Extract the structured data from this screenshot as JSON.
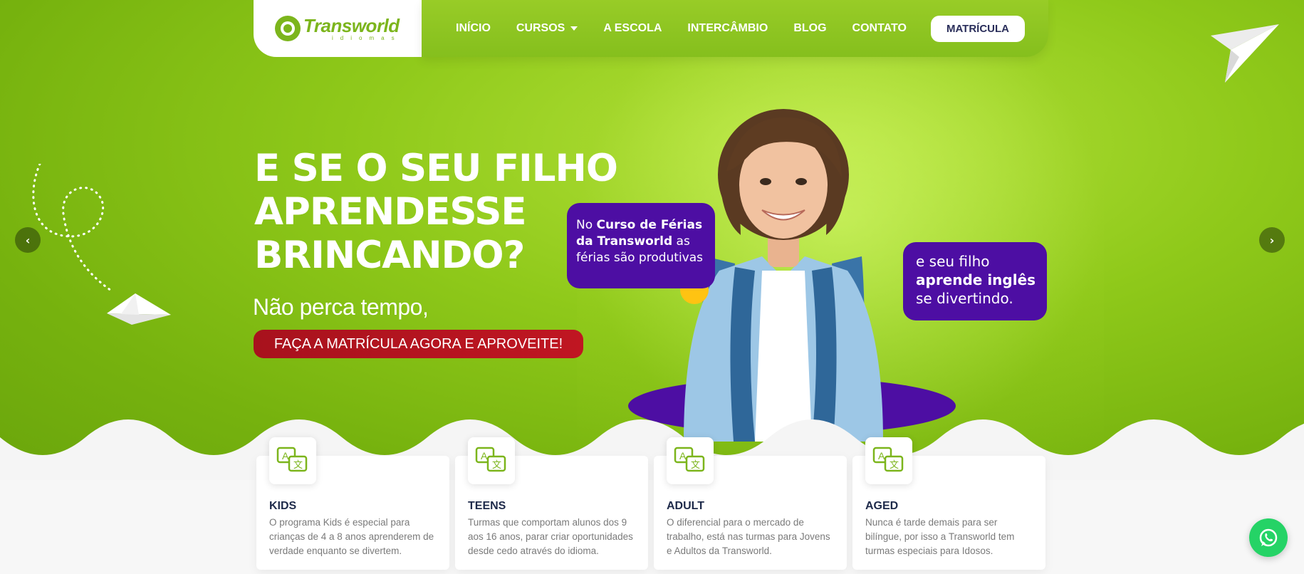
{
  "brand": {
    "logo_text": "Transworld",
    "logo_sub": "idiomas",
    "accent": "#7cb51c",
    "purple": "#4d0ea3",
    "red": "#b3141f"
  },
  "nav": {
    "items": [
      {
        "label": "INÍCIO"
      },
      {
        "label": "CURSOS",
        "has_dropdown": true
      },
      {
        "label": "A ESCOLA"
      },
      {
        "label": "INTERCÂMBIO"
      },
      {
        "label": "BLOG"
      },
      {
        "label": "CONTATO"
      }
    ],
    "cta_label": "MATRÍCULA"
  },
  "hero": {
    "headline_lines": [
      "E SE O SEU FILHO",
      "APRENDESSE",
      "BRINCANDO?"
    ],
    "subline": "Não perca tempo,",
    "cta_label": "FAÇA A MATRÍCULA AGORA E APROVEITE!",
    "bubble1": {
      "pre": "No ",
      "bold": "Curso de Férias da Transworld",
      "post": " as férias são produtivas"
    },
    "bubble2": {
      "pre": "e seu filho ",
      "bold": "aprende inglês",
      "post": " se divertindo."
    },
    "prev_icon": "chevron-left-icon",
    "next_icon": "chevron-right-icon"
  },
  "cards": [
    {
      "icon": "translate-icon",
      "title": "KIDS",
      "text": "O programa Kids é especial para crianças de 4 a 8 anos aprenderem de verdade enquanto se divertem."
    },
    {
      "icon": "translate-icon",
      "title": "TEENS",
      "text": "Turmas que comportam alunos dos 9 aos 16 anos, parar criar oportunidades desde cedo através do idioma."
    },
    {
      "icon": "translate-icon",
      "title": "ADULT",
      "text": "O diferencial para o mercado de trabalho, está nas turmas para Jovens e Adultos da Transworld."
    },
    {
      "icon": "translate-icon",
      "title": "AGED",
      "text": "Nunca é tarde demais para ser bilíngue, por isso a Transworld tem turmas especiais para Idosos."
    }
  ],
  "whatsapp_icon": "whatsapp-icon"
}
